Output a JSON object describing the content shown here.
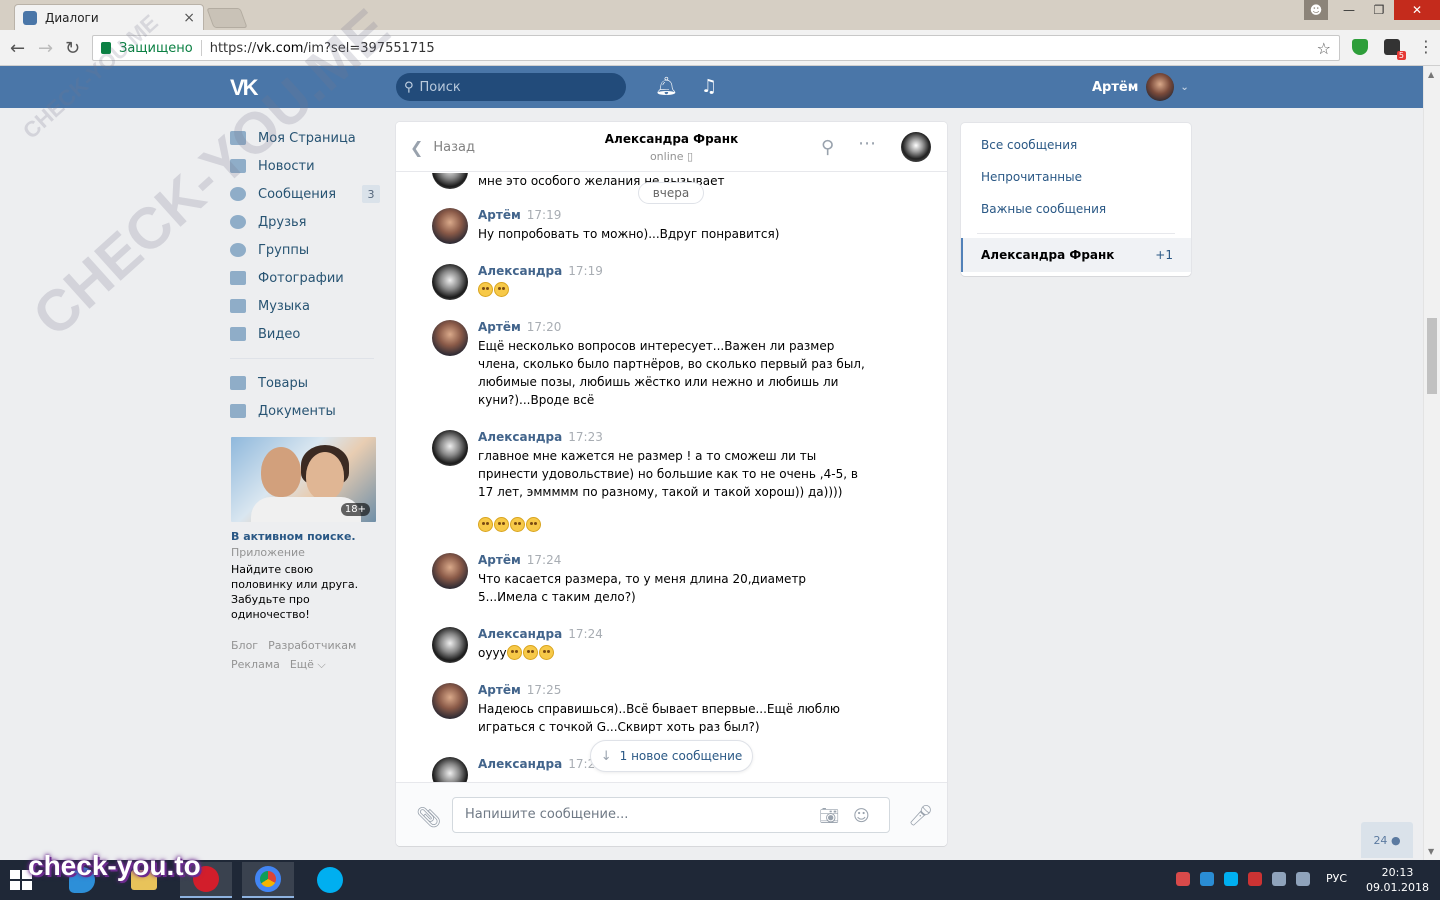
{
  "browser": {
    "tab_title": "Диалоги",
    "tab_close": "×",
    "secure_label": "Защищено",
    "url_scheme": "https://",
    "url_host": "vk.com",
    "url_path": "/im?sel=397551715",
    "ext_badge": "5"
  },
  "header": {
    "search_placeholder": "Поиск",
    "user_name": "Артём"
  },
  "sidebar": {
    "items": [
      {
        "label": "Моя Страница",
        "icon": "home-icon"
      },
      {
        "label": "Новости",
        "icon": "news-icon"
      },
      {
        "label": "Сообщения",
        "icon": "messages-icon",
        "counter": "3"
      },
      {
        "label": "Друзья",
        "icon": "friends-icon"
      },
      {
        "label": "Группы",
        "icon": "groups-icon"
      },
      {
        "label": "Фотографии",
        "icon": "photos-icon"
      },
      {
        "label": "Музыка",
        "icon": "music-icon"
      },
      {
        "label": "Видео",
        "icon": "video-icon"
      },
      {
        "label": "Товары",
        "icon": "market-icon"
      },
      {
        "label": "Документы",
        "icon": "documents-icon"
      }
    ],
    "ad": {
      "badge": "18+",
      "title": "В активном поиске.",
      "subtitle": "Приложение",
      "text": "Найдите свою половинку или друга. Забудьте про одиночество!"
    },
    "footer": {
      "blog": "Блог",
      "developers": "Разработчикам",
      "ads": "Реклама",
      "more": "Ещё ⌵"
    }
  },
  "chat": {
    "back_label": "Назад",
    "peer_name": "Александра Франк",
    "peer_status": "online ▯",
    "date_chip": "вчера",
    "partial_text": "мне это особого желания не вызывает",
    "messages": [
      {
        "author": "Артём",
        "time": "17:19",
        "text": "Ну попробовать то можно)...Вдруг понравится)"
      },
      {
        "author": "Александра",
        "time": "17:19",
        "text": ""
      },
      {
        "author": "Артём",
        "time": "17:20",
        "text": "Ещё несколько вопросов интересует...Важен ли размер члена, сколько было партнёров, во сколько первый раз был, любимые позы, любишь жёстко или нежно и любишь ли куни?)...Вроде всё"
      },
      {
        "author": "Александра",
        "time": "17:23",
        "text": "главное мне кажется не размер ! а то сможеш ли ты принести удовольствие) но большие как то не очень ,4-5, в 17 лет, эммммм по разному, такой и такой хорош)) да))))"
      },
      {
        "author": "Артём",
        "time": "17:24",
        "text": "Что касается размера, то у меня длина 20,диаметр 5...Имела с таким дело?)"
      },
      {
        "author": "Александра",
        "time": "17:24",
        "text": "оууу"
      },
      {
        "author": "Артём",
        "time": "17:25",
        "text": "Надеюсь справишься)..Всё бывает впервые...Ещё люблю играться с точкой G...Сквирт хоть раз был?)"
      },
      {
        "author": "Александра",
        "time": "17:26",
        "text": ""
      }
    ],
    "new_message_label": "1 новое сообщение",
    "composer_placeholder": "Напишите сообщение..."
  },
  "right_panel": {
    "all": "Все сообщения",
    "unread": "Непрочитанные",
    "important": "Важные сообщения",
    "active_dialog": "Александра Франк",
    "active_count": "+1"
  },
  "friends_online": "24",
  "watermarks": {
    "diagonal": "CHECK-YOU.ME",
    "bottom": "check-you.to"
  },
  "taskbar": {
    "lang": "РУС",
    "time": "20:13",
    "date": "09.01.2018"
  },
  "colors": {
    "vk_blue": "#4a76a8",
    "link": "#2a5885",
    "author": "#42648b"
  }
}
